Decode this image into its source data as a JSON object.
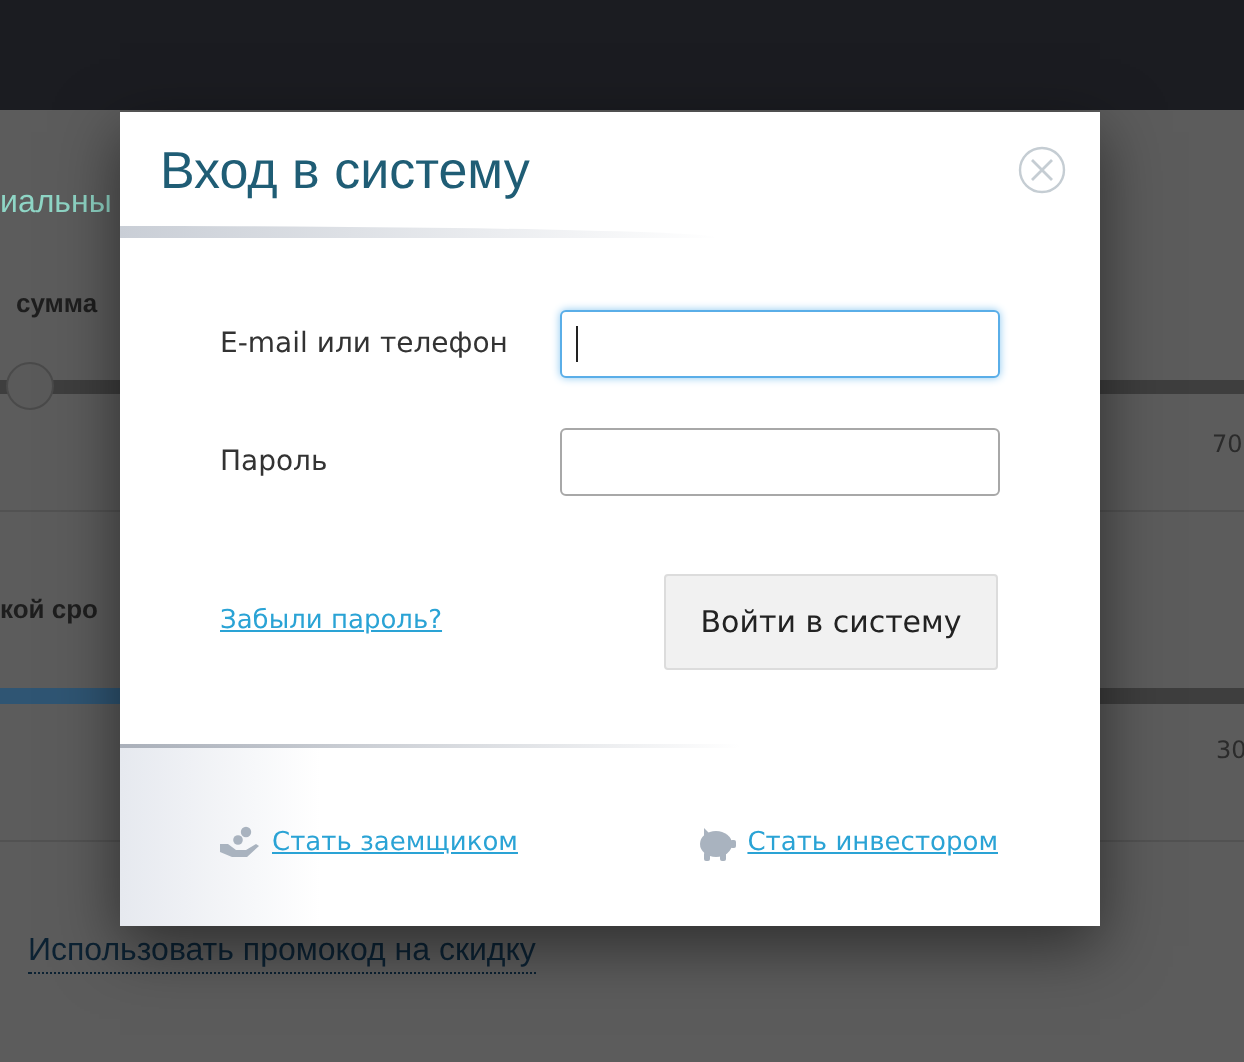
{
  "background": {
    "texts": [
      {
        "kind": "heading",
        "text": "иальны"
      },
      {
        "kind": "label",
        "text": "сумма"
      },
      {
        "kind": "tick",
        "text": "70"
      },
      {
        "kind": "label",
        "text": "кой сро"
      },
      {
        "kind": "tick",
        "text": "30"
      },
      {
        "kind": "link",
        "text": "Использовать промокод на скидку"
      }
    ]
  },
  "dialog": {
    "title": "Вход в систему",
    "fields": [
      {
        "label": "E-mail или телефон",
        "focused": true
      },
      {
        "label": "Пароль",
        "focused": false
      }
    ],
    "forgot_link": "Забыли пароль?",
    "submit_button": "Войти в систему",
    "footer_links": [
      {
        "kind": "borrower",
        "label": "Стать заемщиком"
      },
      {
        "kind": "investor",
        "label": "Стать инвестором"
      }
    ]
  }
}
